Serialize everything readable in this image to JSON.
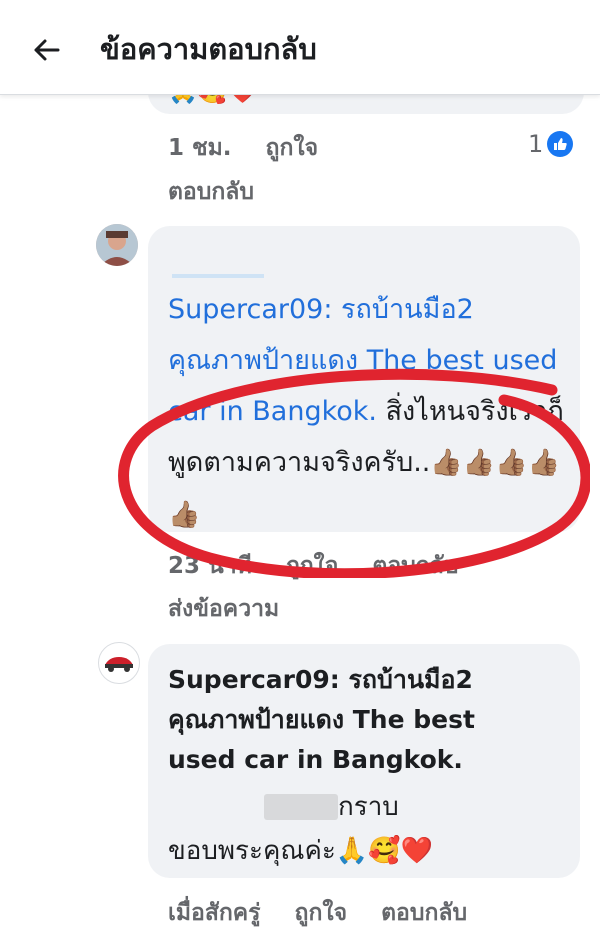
{
  "header": {
    "title": "ข้อความตอบกลับ"
  },
  "top_comment": {
    "emojis": "🙏🥰❤️",
    "time": "1 ชม.",
    "like_label": "ถูกใจ",
    "reply_label": "ตอบกลับ",
    "reaction_count": "1"
  },
  "reply1": {
    "author_name": "",
    "page_link": "Supercar09: รถบ้านมือ2 คุณภาพป้ายแดง The best used car in Bangkok.",
    "text": " สิ่งไหนจริงเราก็พูดตามความจริงครับ..",
    "thumbs": "👍🏽👍🏽👍🏽👍🏽👍🏽",
    "time": "23 นาที",
    "like_label": "ถูกใจ",
    "reply_label": "ตอบกลับ",
    "send_message_label": "ส่งข้อความ"
  },
  "reply2": {
    "author": "Supercar09: รถบ้านมือ2 คุณภาพป้ายแดง The best used car in Bangkok.",
    "line1": "กราบ",
    "line2": "ขอบพระคุณค่ะ",
    "emojis": "🙏🥰❤️",
    "time": "เมื่อสักครู่",
    "like_label": "ถูกใจ",
    "reply_label": "ตอบกลับ"
  },
  "colors": {
    "link": "#216fdb",
    "annotation_circle": "#e0242f",
    "like_badge": "#1877f2"
  }
}
